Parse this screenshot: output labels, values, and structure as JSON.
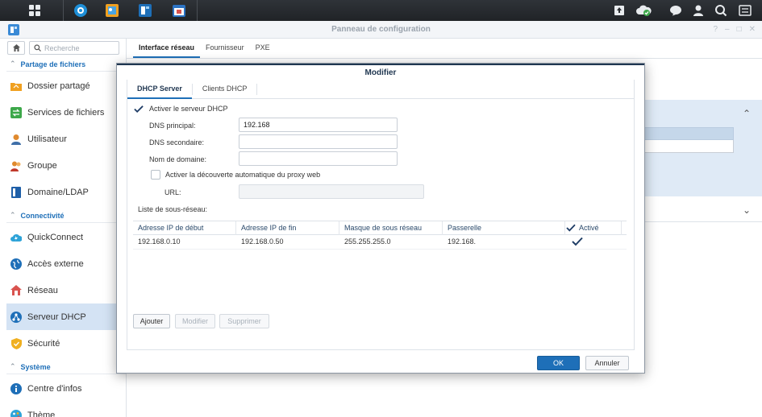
{
  "window": {
    "title": "Panneau de configuration",
    "controls": [
      "?",
      "–",
      "□",
      "✕"
    ]
  },
  "sidebar": {
    "search_placeholder": "Recherche",
    "sections": [
      {
        "label": "Partage de fichiers"
      },
      {
        "label": "Connectivité"
      },
      {
        "label": "Système"
      }
    ],
    "items": [
      {
        "label": "Dossier partagé",
        "icon": "shared-folder-icon",
        "color": "#f0a020"
      },
      {
        "label": "Services de fichiers",
        "icon": "file-services-icon",
        "color": "#3da84a"
      },
      {
        "label": "Utilisateur",
        "icon": "user-icon",
        "color": "#e08a2e"
      },
      {
        "label": "Groupe",
        "icon": "group-icon",
        "color": "#e08a2e"
      },
      {
        "label": "Domaine/LDAP",
        "icon": "domain-ldap-icon",
        "color": "#1e5fa8"
      },
      {
        "label": "QuickConnect",
        "icon": "quickconnect-icon",
        "color": "#2ea3d8"
      },
      {
        "label": "Accès externe",
        "icon": "external-access-icon",
        "color": "#1e6fb8"
      },
      {
        "label": "Réseau",
        "icon": "network-icon",
        "color": "#d9534f"
      },
      {
        "label": "Serveur DHCP",
        "icon": "dhcp-server-icon",
        "color": "#1e6fb8",
        "active": true
      },
      {
        "label": "Sécurité",
        "icon": "security-icon",
        "color": "#f0b020"
      },
      {
        "label": "Centre d'infos",
        "icon": "info-center-icon",
        "color": "#1e6fb8"
      },
      {
        "label": "Thème",
        "icon": "theme-icon",
        "color": "#2ea3d8"
      }
    ]
  },
  "main": {
    "tabs": [
      "Interface réseau",
      "Fournisseur",
      "PXE"
    ]
  },
  "dialog": {
    "title": "Modifier",
    "tabs": [
      "DHCP Server",
      "Clients DHCP"
    ],
    "enable_dhcp_label": "Activer le serveur DHCP",
    "enable_dhcp_checked": true,
    "dns_primary_label": "DNS principal:",
    "dns_primary_value": "192.168",
    "dns_secondary_label": "DNS secondaire:",
    "dns_secondary_value": "",
    "domain_label": "Nom de domaine:",
    "domain_value": "",
    "proxy_label": "Activer la découverte automatique du proxy web",
    "proxy_checked": false,
    "url_label": "URL:",
    "url_value": "",
    "subnet_list_label": "Liste de sous-réseau:",
    "table": {
      "headers": [
        "Adresse IP de début",
        "Adresse IP de fin",
        "Masque de sous réseau",
        "Passerelle",
        "Activé"
      ],
      "rows": [
        {
          "start": "192.168.0.10",
          "end": "192.168.0.50",
          "mask": "255.255.255.0",
          "gateway": "192.168.",
          "enabled": true
        }
      ]
    },
    "buttons": {
      "add": "Ajouter",
      "edit": "Modifier",
      "delete": "Supprimer",
      "ok": "OK",
      "cancel": "Annuler"
    }
  }
}
